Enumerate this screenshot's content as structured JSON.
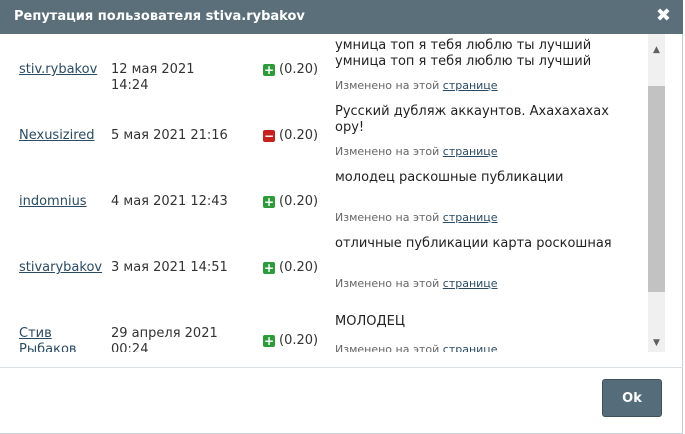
{
  "dialog": {
    "title": "Репутация пользователя stiva.rybakov",
    "ok_label": "Ok"
  },
  "rows": [
    {
      "user": "stiv.rybakov",
      "date": "12 мая 2021 14:24",
      "vote_type": "plus",
      "vote_value": "(0.20)",
      "comment": "умница топ я тебя люблю ты лучший умница топ я тебя люблю ты лучший",
      "changed_prefix": "Изменено на этой",
      "changed_link": "странице"
    },
    {
      "user": "Nexusizired",
      "date": "5 мая 2021 21:16",
      "vote_type": "minus",
      "vote_value": "(0.20)",
      "comment": "Русский дубляж аккаунтов. Ахахахахах ору!",
      "changed_prefix": "Изменено на этой",
      "changed_link": "странице"
    },
    {
      "user": "indomnius",
      "date": "4 мая 2021 12:43",
      "vote_type": "plus",
      "vote_value": "(0.20)",
      "comment": "молодец раскошные публикации",
      "changed_prefix": "Изменено на этой",
      "changed_link": "странице"
    },
    {
      "user": "stivarybakov",
      "date": "3 мая 2021 14:51",
      "vote_type": "plus",
      "vote_value": "(0.20)",
      "comment": "отличные публикации карта роскошная",
      "changed_prefix": "Изменено на этой",
      "changed_link": "странице"
    },
    {
      "user": "Стив Рыбаков",
      "date": "29 апреля 2021 00:24",
      "vote_type": "plus",
      "vote_value": "(0.20)",
      "comment": "МОЛОДЕЦ",
      "changed_prefix": "Изменено на этой",
      "changed_link": "странице"
    }
  ],
  "icons": {
    "close": "close-icon",
    "plus": "plus-icon",
    "minus": "minus-icon"
  },
  "colors": {
    "titlebar": "#5b6f7b",
    "plus": "#2c9b3a",
    "minus": "#c8201c",
    "button": "#556d7a"
  }
}
